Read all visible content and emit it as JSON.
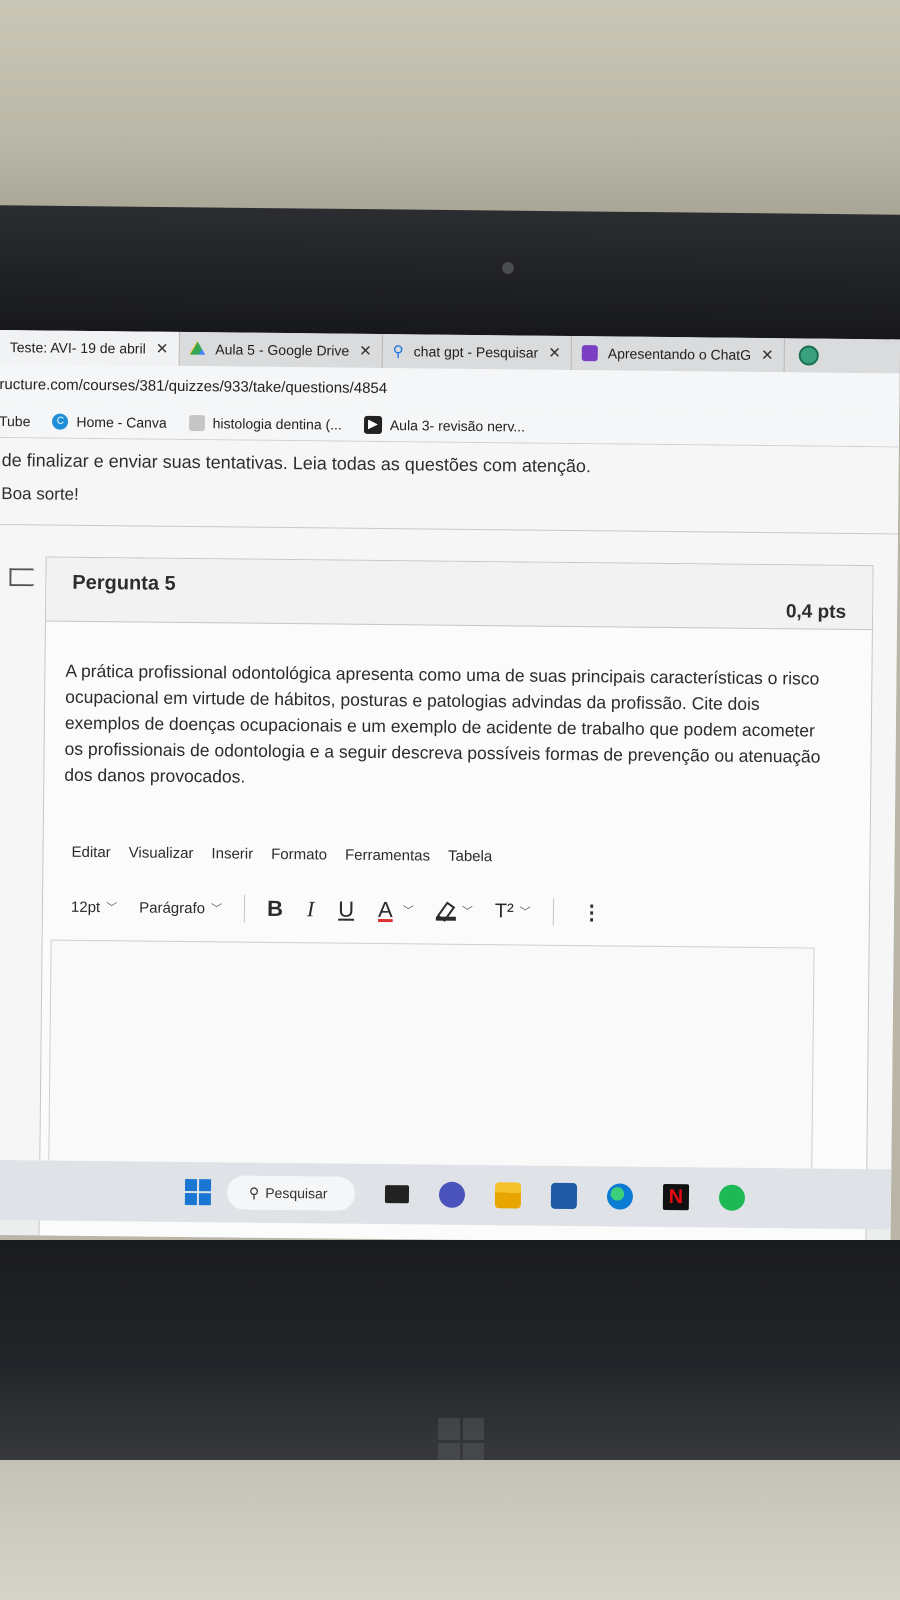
{
  "browser": {
    "tabs": [
      {
        "label": "Teste: AVI- 19 de abril",
        "icon": "canvas-icon",
        "close": "✕",
        "active": true
      },
      {
        "label": "Aula 5 - Google Drive",
        "icon": "google-drive-icon",
        "close": "✕",
        "active": false
      },
      {
        "label": "chat gpt - Pesquisar",
        "icon": "search-icon",
        "close": "✕",
        "active": false
      },
      {
        "label": "Apresentando o ChatG",
        "icon": "openai-icon",
        "close": "✕",
        "active": false
      }
    ],
    "url": "ructure.com/courses/381/quizzes/933/take/questions/4854",
    "bookmarks": [
      {
        "label": "Tube",
        "icon": "youtube-icon"
      },
      {
        "label": "Home - Canva",
        "icon": "canva-icon"
      },
      {
        "label": "histologia dentina (...",
        "icon": "bookmark-icon"
      },
      {
        "label": "Aula 3- revisão nerv...",
        "icon": "video-icon"
      }
    ]
  },
  "page": {
    "intro": "de finalizar e enviar suas tentativas. Leia todas as questões com atenção.",
    "good_luck": "Boa sorte!"
  },
  "question": {
    "title": "Pergunta 5",
    "points": "0,4 pts",
    "text": "A prática profissional odontológica apresenta como uma de suas principais características o risco ocupacional em virtude de hábitos, posturas e patologias advindas da profissão. Cite dois exemplos de doenças ocupacionais e um exemplo de acidente de trabalho que podem  acometer os profissionais de odontologia e a seguir descreva  possíveis formas de prevenção ou atenuação dos danos provocados."
  },
  "editor": {
    "menu": [
      "Editar",
      "Visualizar",
      "Inserir",
      "Formato",
      "Ferramentas",
      "Tabela"
    ],
    "font_size": "12pt",
    "block_format": "Parágrafo",
    "bold": "B",
    "italic": "I",
    "underline": "U",
    "font_color": "A",
    "superscript": "T²",
    "more": "⋮",
    "content": ""
  },
  "taskbar": {
    "search_label": "Pesquisar",
    "apps": [
      "start-icon",
      "task-view-icon",
      "teams-meet-icon",
      "file-explorer-icon",
      "store-icon",
      "edge-icon",
      "netflix-icon",
      "spotify-icon"
    ],
    "netflix_letter": "N"
  },
  "colors": {
    "windows_blue": "#1976d2",
    "netflix_red": "#e50914",
    "spotify_green": "#1db954"
  }
}
